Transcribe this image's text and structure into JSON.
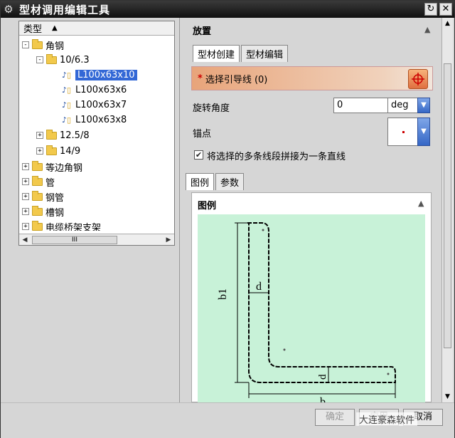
{
  "window": {
    "title": "型材调用编辑工具",
    "app_icon": "gear-icon"
  },
  "tree": {
    "header": "类型",
    "nodes": [
      {
        "label": "角钢",
        "expander": "-",
        "kind": "folder"
      },
      {
        "label": "10/6.3",
        "expander": "-",
        "kind": "folder"
      },
      {
        "label": "L100x63x10",
        "kind": "leaf",
        "selected": true
      },
      {
        "label": "L100x63x6",
        "kind": "leaf"
      },
      {
        "label": "L100x63x7",
        "kind": "leaf"
      },
      {
        "label": "L100x63x8",
        "kind": "leaf"
      },
      {
        "label": "12.5/8",
        "expander": "+",
        "kind": "folder"
      },
      {
        "label": "14/9",
        "expander": "+",
        "kind": "folder"
      },
      {
        "label": "等边角钢",
        "expander": "+",
        "kind": "folder"
      },
      {
        "label": "管",
        "expander": "+",
        "kind": "folder"
      },
      {
        "label": "钢管",
        "expander": "+",
        "kind": "folder"
      },
      {
        "label": "槽钢",
        "expander": "+",
        "kind": "folder"
      },
      {
        "label": "电缆桥架支架",
        "expander": "+",
        "kind": "folder"
      }
    ],
    "scroll_thumb": "III"
  },
  "placement": {
    "title": "放置",
    "tabs": [
      "型材创建",
      "型材编辑"
    ],
    "select_label": "选择引导线 (0)",
    "rotation_label": "旋转角度",
    "rotation_value": "0",
    "rotation_unit": "deg",
    "anchor_label": "锚点",
    "merge_label": "将选择的多条线段拼接为一条直线",
    "merge_checked": true
  },
  "legend_tabs": [
    "图例",
    "参数"
  ],
  "figure": {
    "title": "图例",
    "dim_b1": "b1",
    "dim_d_vertical": "d",
    "dim_d_horizontal": "d",
    "dim_b": "b"
  },
  "footer": {
    "ok_label": "确定",
    "apply_label": "应用",
    "cancel_label": "取消",
    "watermark": "大连豪森软件"
  }
}
